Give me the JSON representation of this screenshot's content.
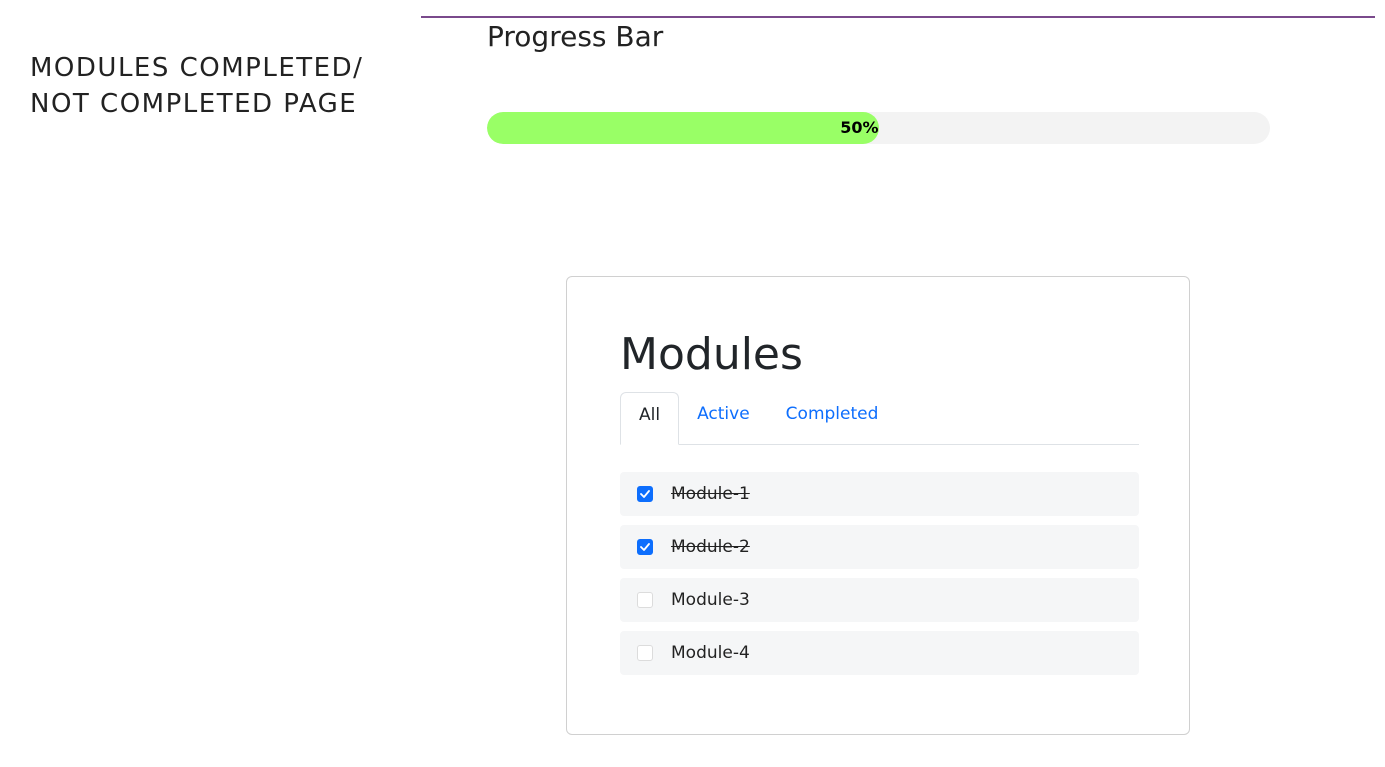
{
  "sidebar": {
    "title_line1": "MODULES COMPLETED/",
    "title_line2": "NOT COMPLETED PAGE"
  },
  "progress": {
    "heading": "Progress Bar",
    "percent": 50,
    "label": "50%"
  },
  "modules_card": {
    "title": "Modules",
    "tabs": [
      {
        "label": "All",
        "active": true
      },
      {
        "label": "Active",
        "active": false
      },
      {
        "label": "Completed",
        "active": false
      }
    ],
    "items": [
      {
        "label": "Module-1",
        "checked": true
      },
      {
        "label": "Module-2",
        "checked": true
      },
      {
        "label": "Module-3",
        "checked": false
      },
      {
        "label": "Module-4",
        "checked": false
      }
    ]
  },
  "colors": {
    "progress_fill": "#99ff66",
    "accent": "#0d6efd",
    "rule": "#7a4a8c"
  }
}
